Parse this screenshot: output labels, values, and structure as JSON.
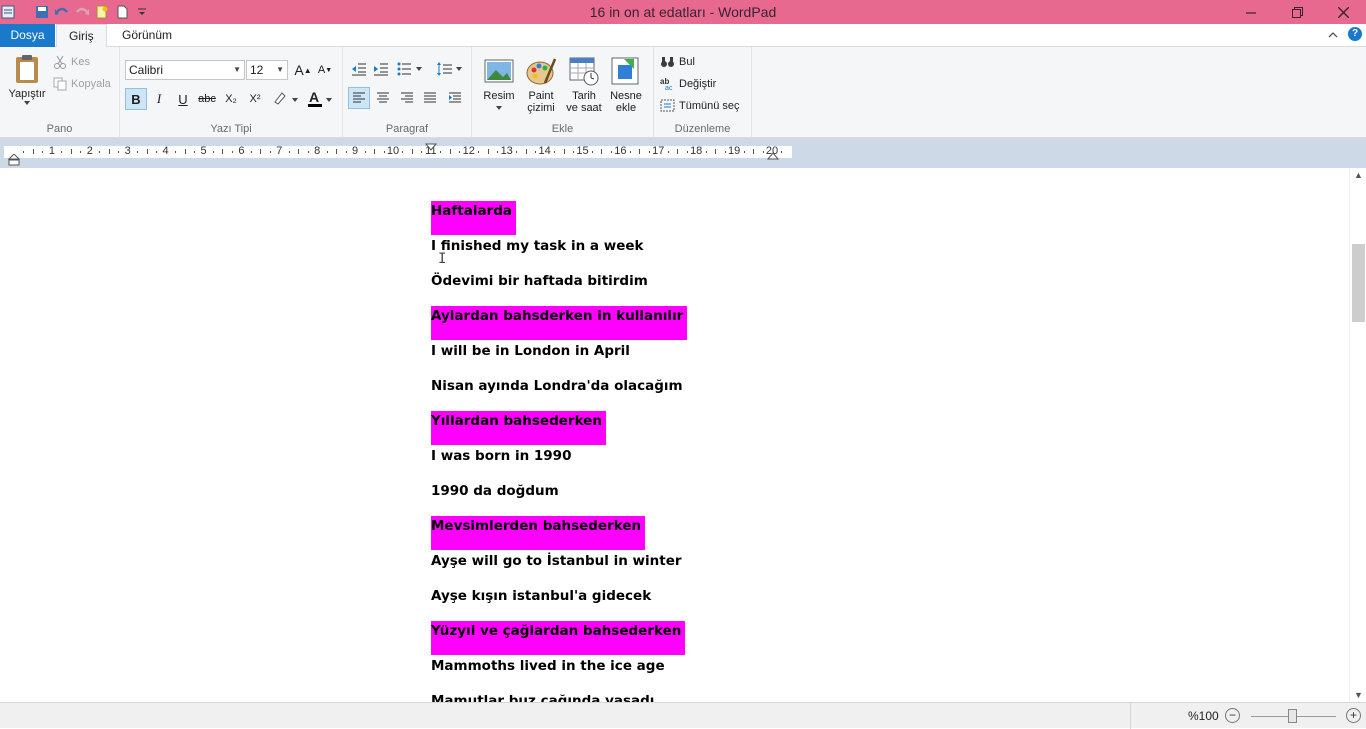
{
  "window": {
    "title": "16 in on at edatları - WordPad",
    "controls": [
      "minimize-icon",
      "maximize-icon",
      "close-icon"
    ]
  },
  "quick_access": [
    "app-icon",
    "save-icon",
    "undo-icon",
    "redo-icon",
    "new-icon",
    "document-icon",
    "customize-icon"
  ],
  "tabs": {
    "file": "Dosya",
    "home": "Giriş",
    "view": "Görünüm"
  },
  "ribbon": {
    "clipboard": {
      "label": "Pano",
      "paste": "Yapıştır",
      "cut": "Kes",
      "copy": "Kopyala"
    },
    "font": {
      "label": "Yazı Tipi",
      "family": "Calibri",
      "size": "12",
      "bold": "B",
      "italic": "I",
      "underline": "U",
      "strike": "abc",
      "subscript": "X₂",
      "superscript": "X²",
      "color_accent": "#e81123"
    },
    "paragraph": {
      "label": "Paragraf"
    },
    "insert": {
      "label": "Ekle",
      "picture": "Resim",
      "paint_line1": "Paint",
      "paint_line2": "çizimi",
      "datetime_line1": "Tarih",
      "datetime_line2": "ve saat",
      "object_line1": "Nesne",
      "object_line2": "ekle"
    },
    "editing": {
      "label": "Düzenleme",
      "find": "Bul",
      "replace": "Değiştir",
      "select_all": "Tümünü seç"
    }
  },
  "ruler": {
    "numbers": [
      "1",
      "2",
      "3",
      "4",
      "5",
      "6",
      "7",
      "8",
      "9",
      "10",
      "11",
      "12",
      "13",
      "14",
      "15",
      "16",
      "17",
      "18",
      "19",
      "20"
    ]
  },
  "document": {
    "highlight_color": "#ff00ff",
    "lines": [
      {
        "text": "Haftalarda",
        "highlight": true
      },
      {
        "text": "I finished my task in a week",
        "highlight": false
      },
      {
        "text": "Ödevimi bir haftada bitirdim",
        "highlight": false
      },
      {
        "text": "Aylardan bahsderken in kullanılır",
        "highlight": true
      },
      {
        "text": "I will be in London in April",
        "highlight": false
      },
      {
        "text": "Nisan ayında Londra'da olacağım",
        "highlight": false
      },
      {
        "text": "Yıllardan bahsederken",
        "highlight": true
      },
      {
        "text": "I was born in 1990",
        "highlight": false
      },
      {
        "text": "1990 da doğdum",
        "highlight": false
      },
      {
        "text": "Mevsimlerden bahsederken",
        "highlight": true
      },
      {
        "text": "Ayşe will go to İstanbul in winter",
        "highlight": false
      },
      {
        "text": "Ayşe kışın istanbul'a gidecek",
        "highlight": false
      },
      {
        "text": "Yüzyıl ve çağlardan bahsederken",
        "highlight": true
      },
      {
        "text": "Mammoths lived in the ice age",
        "highlight": false
      },
      {
        "text": "Mamutlar buz çağında yaşadı",
        "highlight": false
      }
    ]
  },
  "status": {
    "zoom": "%100",
    "zoom_level": 1.0
  }
}
